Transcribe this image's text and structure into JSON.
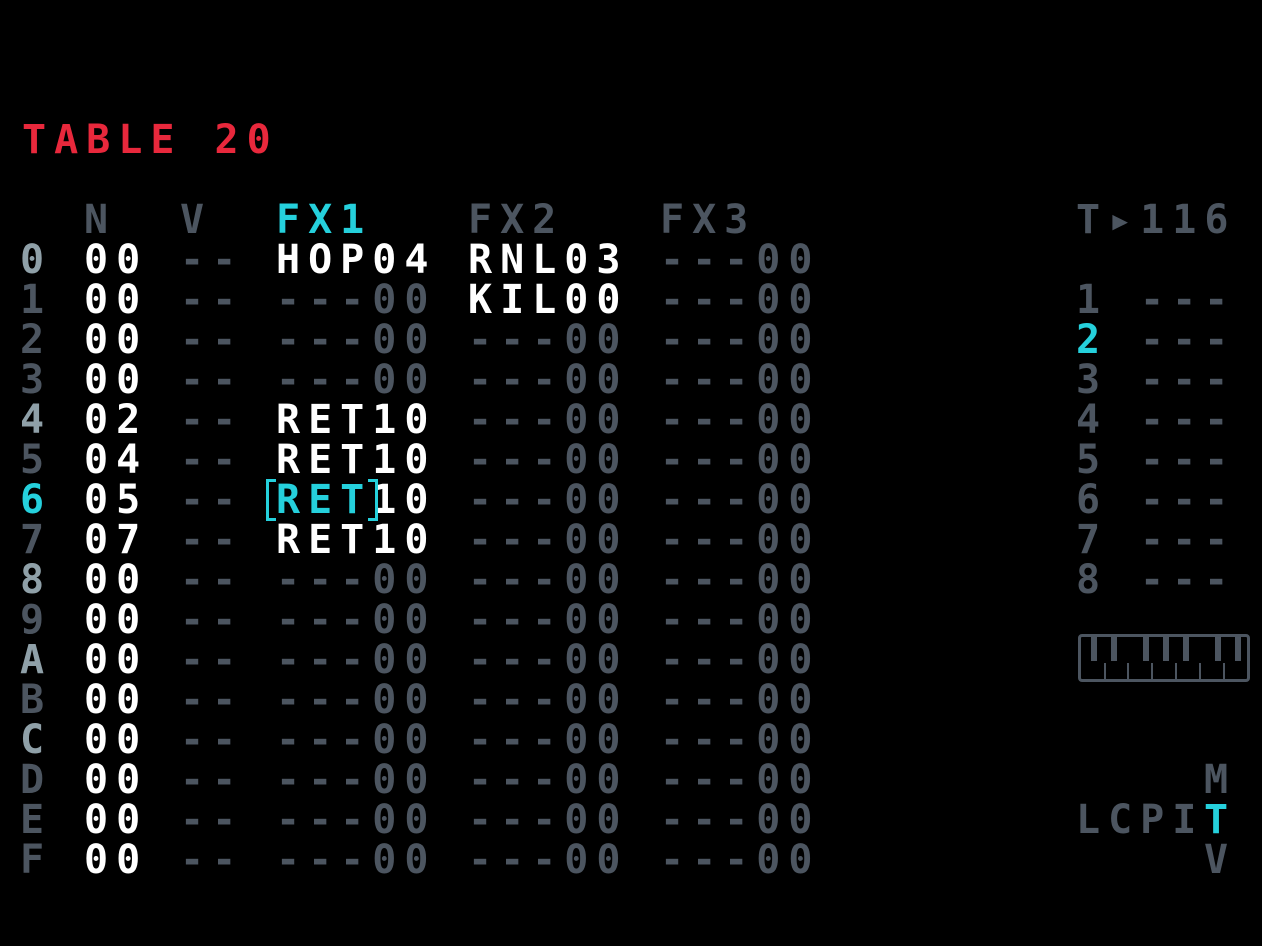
{
  "title": "TABLE 20",
  "columns": {
    "n": "N",
    "v": "V",
    "fx1": "FX1",
    "fx2": "FX2",
    "fx3": "FX3"
  },
  "rows": [
    {
      "idx": "0",
      "n": "00",
      "v": "--",
      "fx1": "HOP04",
      "fx2": "RNL03",
      "fx3": "---00"
    },
    {
      "idx": "1",
      "n": "00",
      "v": "--",
      "fx1": "---00",
      "fx2": "KIL00",
      "fx3": "---00"
    },
    {
      "idx": "2",
      "n": "00",
      "v": "--",
      "fx1": "---00",
      "fx2": "---00",
      "fx3": "---00"
    },
    {
      "idx": "3",
      "n": "00",
      "v": "--",
      "fx1": "---00",
      "fx2": "---00",
      "fx3": "---00"
    },
    {
      "idx": "4",
      "n": "02",
      "v": "--",
      "fx1": "RET10",
      "fx2": "---00",
      "fx3": "---00"
    },
    {
      "idx": "5",
      "n": "04",
      "v": "--",
      "fx1": "RET10",
      "fx2": "---00",
      "fx3": "---00"
    },
    {
      "idx": "6",
      "n": "05",
      "v": "--",
      "fx1": "RET10",
      "fx2": "---00",
      "fx3": "---00"
    },
    {
      "idx": "7",
      "n": "07",
      "v": "--",
      "fx1": "RET10",
      "fx2": "---00",
      "fx3": "---00"
    },
    {
      "idx": "8",
      "n": "00",
      "v": "--",
      "fx1": "---00",
      "fx2": "---00",
      "fx3": "---00"
    },
    {
      "idx": "9",
      "n": "00",
      "v": "--",
      "fx1": "---00",
      "fx2": "---00",
      "fx3": "---00"
    },
    {
      "idx": "A",
      "n": "00",
      "v": "--",
      "fx1": "---00",
      "fx2": "---00",
      "fx3": "---00"
    },
    {
      "idx": "B",
      "n": "00",
      "v": "--",
      "fx1": "---00",
      "fx2": "---00",
      "fx3": "---00"
    },
    {
      "idx": "C",
      "n": "00",
      "v": "--",
      "fx1": "---00",
      "fx2": "---00",
      "fx3": "---00"
    },
    {
      "idx": "D",
      "n": "00",
      "v": "--",
      "fx1": "---00",
      "fx2": "---00",
      "fx3": "---00"
    },
    {
      "idx": "E",
      "n": "00",
      "v": "--",
      "fx1": "---00",
      "fx2": "---00",
      "fx3": "---00"
    },
    {
      "idx": "F",
      "n": "00",
      "v": "--",
      "fx1": "---00",
      "fx2": "---00",
      "fx3": "---00"
    }
  ],
  "selected_row": 6,
  "tempo": "T▸116",
  "tracks": [
    {
      "num": "1",
      "val": "---"
    },
    {
      "num": "2",
      "val": "---"
    },
    {
      "num": "3",
      "val": "---"
    },
    {
      "num": "4",
      "val": "---"
    },
    {
      "num": "5",
      "val": "---"
    },
    {
      "num": "6",
      "val": "---"
    },
    {
      "num": "7",
      "val": "---"
    },
    {
      "num": "8",
      "val": "---"
    }
  ],
  "active_track": 1,
  "screen_map": {
    "top": "M",
    "left": "LCPI",
    "current": "T",
    "bottom": "V"
  },
  "colors": {
    "accent": "#25d0dc",
    "title": "#e8283c",
    "dim": "#4c5560",
    "text": "#ffffff"
  },
  "icons": {
    "keyboard": "piano-keyboard-icon"
  }
}
